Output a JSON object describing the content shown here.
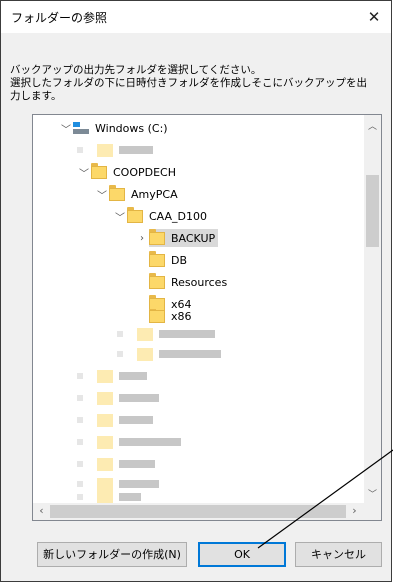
{
  "dialog": {
    "title": "フォルダーの参照",
    "close_glyph": "✕",
    "description_line1": "バックアップの出力先フォルダを選択してください。",
    "description_line2": "選択したフォルダの下に日時付きフォルダを作成しそこにバックアップを出",
    "description_line3": "力します。"
  },
  "tree": {
    "drive_label": "Windows (C:)",
    "company_folder": "COOPDECH",
    "app_folder": "AmyPCA",
    "product_folder": "CAA_D100",
    "children": [
      {
        "label": "BACKUP",
        "selected": true,
        "expandable": true
      },
      {
        "label": "DB",
        "selected": false,
        "expandable": false
      },
      {
        "label": "Resources",
        "selected": false,
        "expandable": false
      },
      {
        "label": "x64",
        "selected": false,
        "expandable": false
      },
      {
        "label": "x86",
        "selected": false,
        "expandable": false
      }
    ]
  },
  "buttons": {
    "new_folder": "新しいフォルダーの作成(N)",
    "ok": "OK",
    "cancel": "キャンセル"
  },
  "colors": {
    "focus_border": "#0078d7",
    "folder_yellow": "#fcd869",
    "selection_gray": "#d9d9d9"
  }
}
